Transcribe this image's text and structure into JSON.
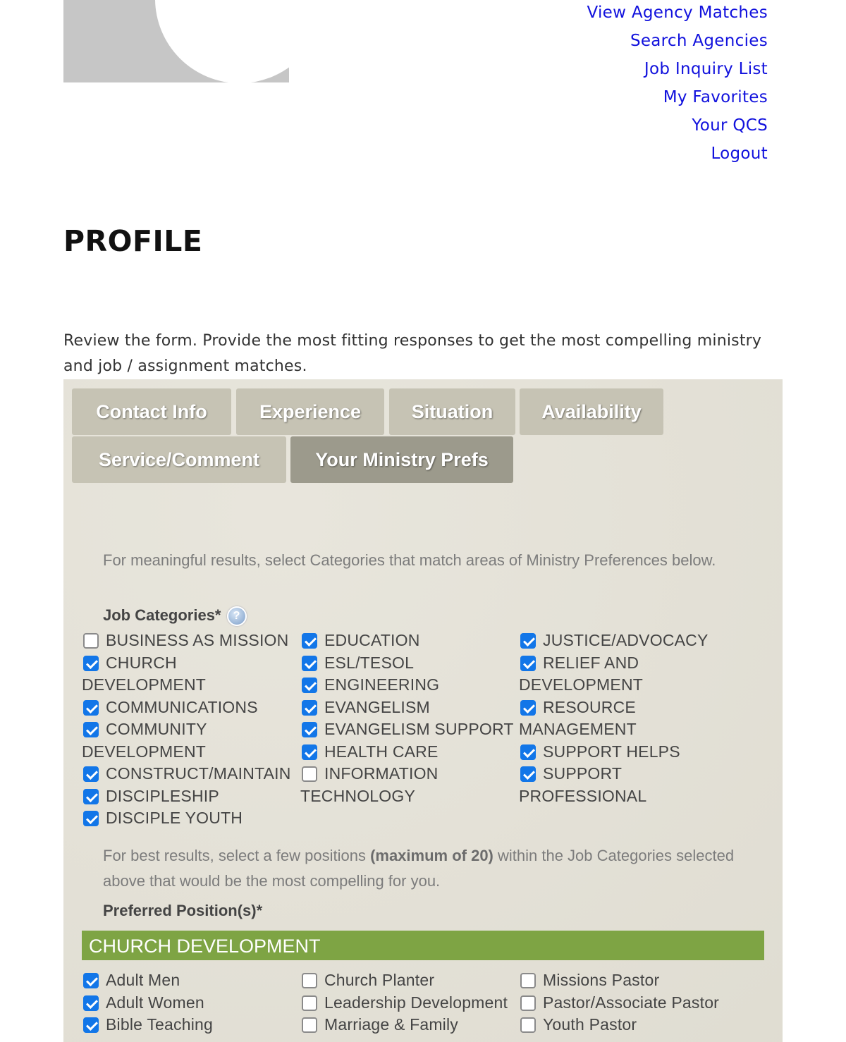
{
  "nav": {
    "links": [
      "View Agency Matches",
      "Search Agencies",
      "Job Inquiry List",
      "My Favorites",
      "Your QCS",
      "Logout"
    ]
  },
  "page": {
    "title": "PROFILE",
    "intro": "Review the form. Provide the most fitting responses to get the most compelling ministry and job / assignment matches."
  },
  "tabs": {
    "contact": "Contact Info",
    "experience": "Experience",
    "situation": "Situation",
    "availability": "Availability",
    "service": "Service/Comment",
    "ministry": "Your Ministry Prefs"
  },
  "form": {
    "categories_note": "For meaningful results, select Categories that match areas of Ministry Preferences below.",
    "categories_label": "Job Categories*",
    "help_glyph": "?",
    "positions_note_a": "For best results, select a few positions ",
    "positions_note_b": "(maximum of 20)",
    "positions_note_c": " within the Job Categories selected above that would be the most compelling for you.",
    "positions_label": "Preferred Position(s)*",
    "section_title": "CHURCH DEVELOPMENT"
  },
  "categories": {
    "col1": [
      {
        "label": "BUSINESS AS MISSION",
        "checked": false
      },
      {
        "label": "CHURCH",
        "cont": "DEVELOPMENT",
        "checked": true
      },
      {
        "label": "COMMUNICATIONS",
        "checked": true
      },
      {
        "label": "COMMUNITY",
        "cont": "DEVELOPMENT",
        "checked": true
      },
      {
        "label": "CONSTRUCT/MAINTAIN",
        "checked": true
      },
      {
        "label": "DISCIPLESHIP",
        "checked": true
      },
      {
        "label": "DISCIPLE YOUTH",
        "checked": true
      }
    ],
    "col2": [
      {
        "label": "EDUCATION",
        "checked": true
      },
      {
        "label": "ESL/TESOL",
        "checked": true
      },
      {
        "label": "ENGINEERING",
        "checked": true
      },
      {
        "label": "EVANGELISM",
        "checked": true
      },
      {
        "label": "EVANGELISM SUPPORT",
        "checked": true
      },
      {
        "label": "HEALTH CARE",
        "checked": true
      },
      {
        "label": "INFORMATION",
        "cont": "TECHNOLOGY",
        "checked": false
      }
    ],
    "col3": [
      {
        "label": "JUSTICE/ADVOCACY",
        "checked": true
      },
      {
        "label": "RELIEF AND",
        "cont": "DEVELOPMENT",
        "checked": true
      },
      {
        "label": "RESOURCE",
        "cont": "MANAGEMENT",
        "checked": true
      },
      {
        "label": "SUPPORT HELPS",
        "checked": true
      },
      {
        "label": "SUPPORT",
        "cont": "PROFESSIONAL",
        "checked": true
      }
    ]
  },
  "positions": {
    "col1": [
      {
        "label": "Adult Men",
        "checked": true
      },
      {
        "label": "Adult Women",
        "checked": true
      },
      {
        "label": "Bible Teaching",
        "checked": true
      }
    ],
    "col2": [
      {
        "label": "Church Planter",
        "checked": false
      },
      {
        "label": "Leadership Development",
        "checked": false
      },
      {
        "label": "Marriage & Family",
        "checked": false
      }
    ],
    "col3": [
      {
        "label": "Missions Pastor",
        "checked": false
      },
      {
        "label": "Pastor/Associate Pastor",
        "checked": false
      },
      {
        "label": "Youth Pastor",
        "checked": false
      }
    ]
  }
}
